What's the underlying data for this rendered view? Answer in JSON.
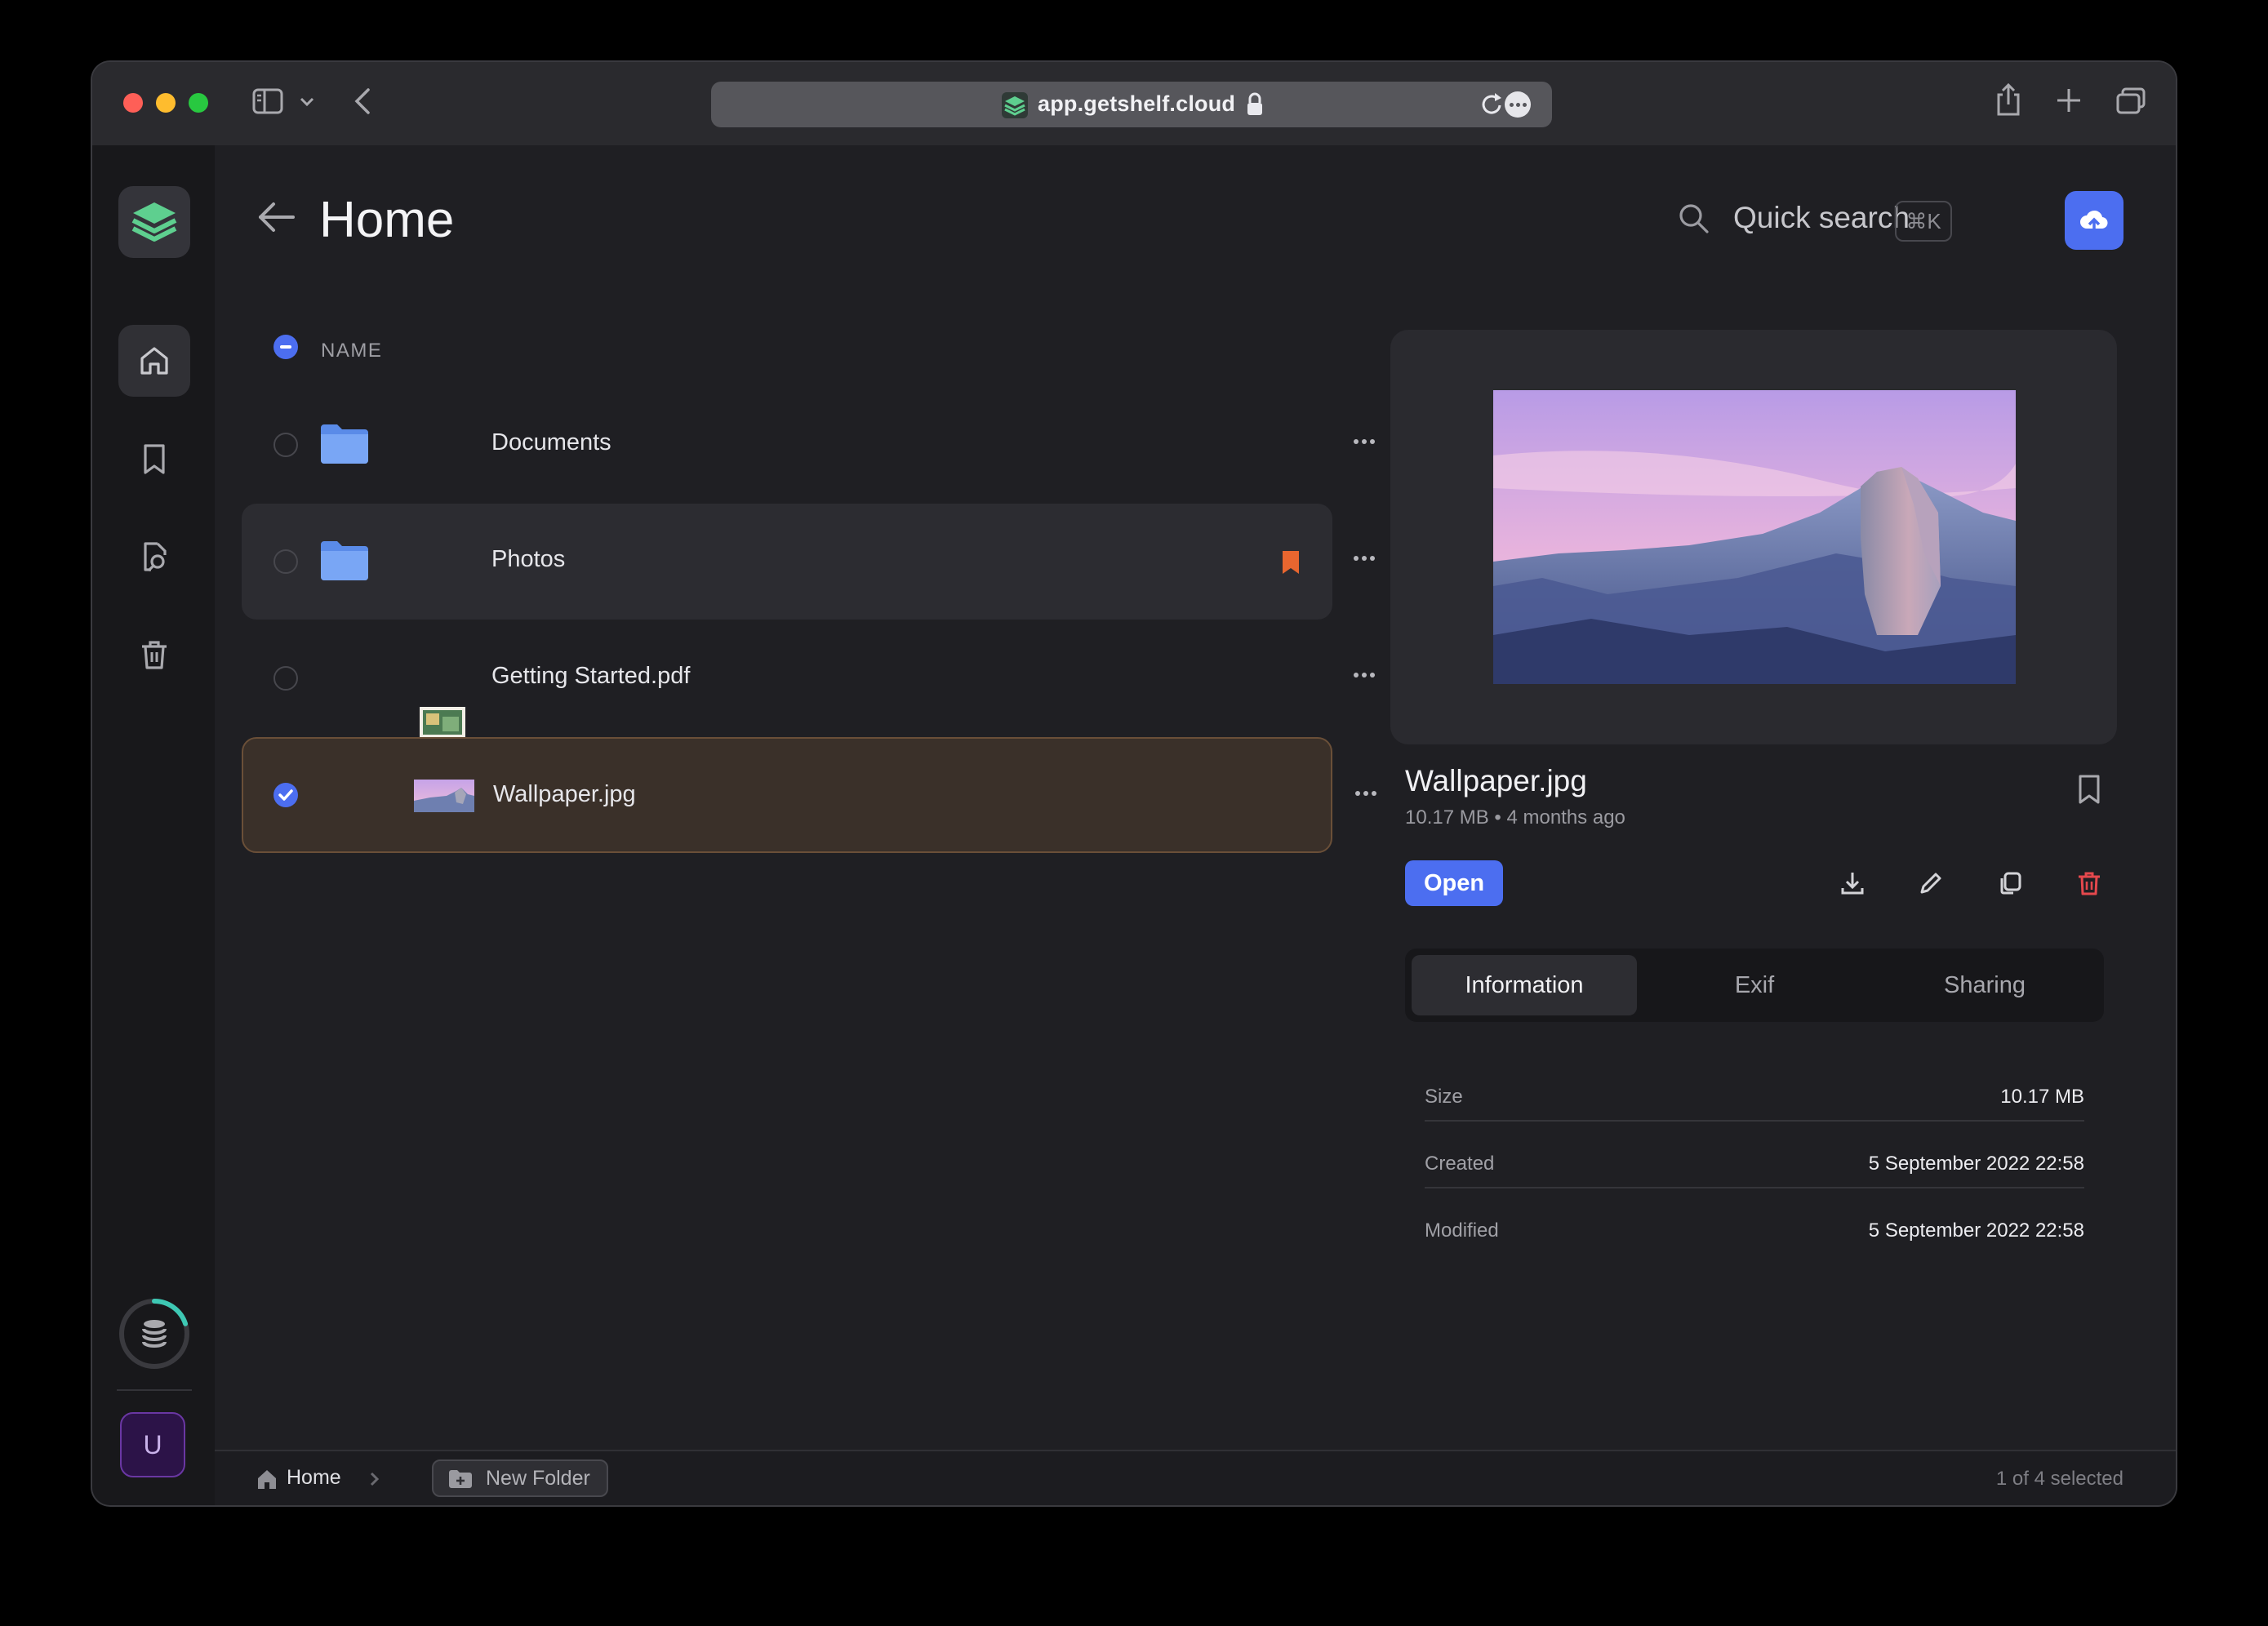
{
  "browser": {
    "url": "app.getshelf.cloud"
  },
  "sidebar": {
    "items": [
      {
        "name": "home",
        "icon": "home-icon",
        "active": true
      },
      {
        "name": "bookmarks",
        "icon": "bookmark-icon",
        "active": false
      },
      {
        "name": "search",
        "icon": "file-search-icon",
        "active": false
      },
      {
        "name": "trash",
        "icon": "trash-icon",
        "active": false
      }
    ],
    "storage_icon": "database-icon",
    "storage_used_fraction": 0.2,
    "avatar_initial": "U"
  },
  "header": {
    "title": "Home",
    "search_label": "Quick search",
    "shortcut": "⌘K"
  },
  "list": {
    "column_name": "NAME",
    "files": [
      {
        "name": "Documents",
        "type": "folder",
        "bookmarked": false,
        "checked": false
      },
      {
        "name": "Photos",
        "type": "folder",
        "bookmarked": true,
        "checked": false
      },
      {
        "name": "Getting Started.pdf",
        "type": "pdf",
        "bookmarked": false,
        "checked": false
      },
      {
        "name": "Wallpaper.jpg",
        "type": "image",
        "bookmarked": false,
        "checked": true
      }
    ]
  },
  "details": {
    "title": "Wallpaper.jpg",
    "meta": "10.17 MB • 4 months ago",
    "open_label": "Open",
    "tabs": [
      "Information",
      "Exif",
      "Sharing"
    ],
    "active_tab": "Information",
    "info": [
      {
        "key": "Size",
        "value": "10.17 MB"
      },
      {
        "key": "Created",
        "value": "5 September 2022 22:58"
      },
      {
        "key": "Modified",
        "value": "5 September 2022 22:58"
      }
    ]
  },
  "footer": {
    "breadcrumb_home": "Home",
    "new_folder_label": "New Folder",
    "selection": "1 of 4 selected"
  },
  "colors": {
    "accent": "#4c6ef0",
    "bookmark": "#e8662f",
    "delete": "#e5484d",
    "logo": "#5ecf8f",
    "storage_ring": "#3ec8b4"
  }
}
